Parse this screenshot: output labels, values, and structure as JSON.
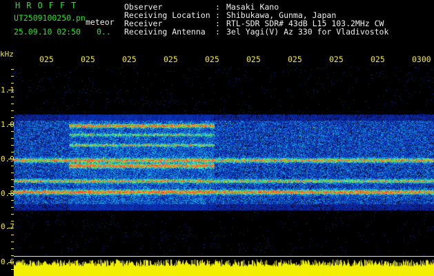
{
  "header": {
    "title": "HROFFT",
    "filename": "UT2509100250.pn",
    "sublabel": "meteor",
    "datetime": "25.09.10 02:50",
    "ellipsis": "0..",
    "fields": [
      {
        "label": "Observer",
        "value": "Masaki Kano"
      },
      {
        "label": "Receiving Location",
        "value": "Shibukawa, Gunma, Japan"
      },
      {
        "label": "Receiver",
        "value": "RTL-SDR SDR# 43dB L15 103.2MHz CW"
      },
      {
        "label": "Receiving Antenna",
        "value": "3el Yagi(V) Az 330 for Vladivostok"
      }
    ]
  },
  "axes": {
    "y_unit": "kHz",
    "y_ticks": [
      "1.1",
      "1.0",
      "0.9",
      "0.8",
      "0.7",
      "0.6"
    ],
    "x_ticks": [
      "025",
      "025",
      "025",
      "025",
      "025",
      "025",
      "025",
      "025",
      "025",
      "0300"
    ]
  },
  "colors": {
    "header_green": "#22e822",
    "axis_yellow": "#f2e838",
    "background": "#000000"
  }
}
